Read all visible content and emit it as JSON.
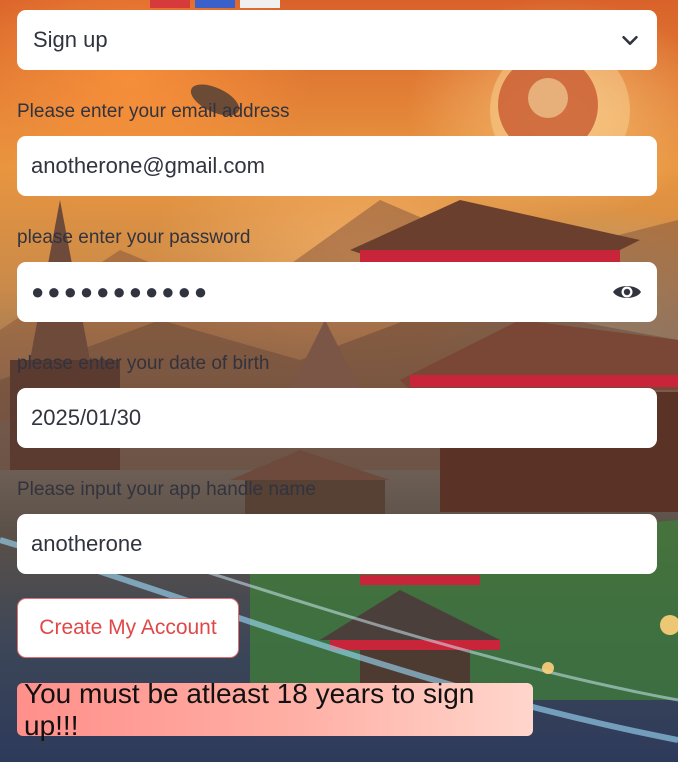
{
  "auth_mode_select": {
    "value": "Sign up"
  },
  "email": {
    "label": "Please enter your email address",
    "value": "anotherone@gmail.com"
  },
  "password": {
    "label": "please enter your password",
    "masked_value": "●●●●●●●●●●●"
  },
  "dob": {
    "label": "please enter your date of birth",
    "value": "2025/01/30"
  },
  "handle": {
    "label": "Please input your app handle name",
    "value": "anotherone"
  },
  "create_button": {
    "label": "Create My Account"
  },
  "error_alert": {
    "message": "You must be atleast 18 years to sign up!!!"
  },
  "icons": {
    "select_chevron": "chevron-down-icon",
    "password_toggle": "eye-icon"
  }
}
